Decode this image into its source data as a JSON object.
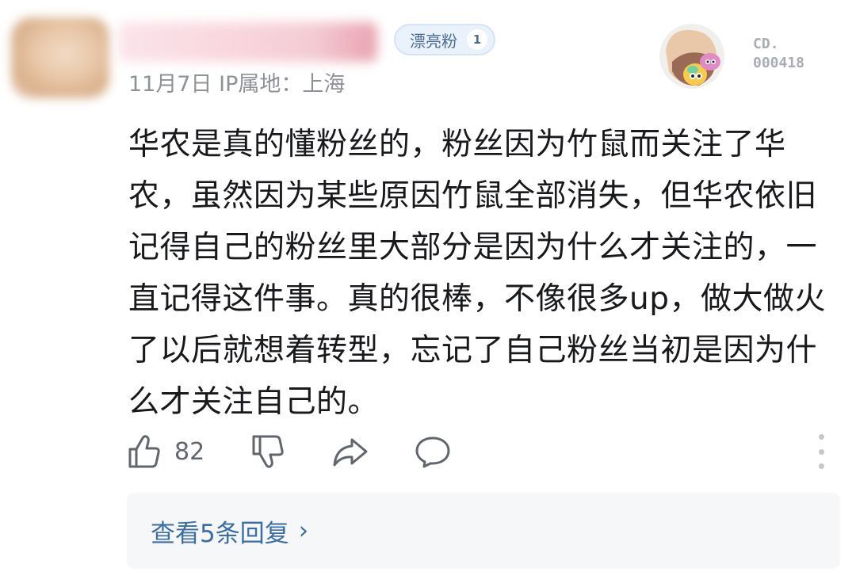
{
  "comment": {
    "fan_badge": {
      "label": "漂亮粉",
      "level": "1"
    },
    "meta": {
      "date": "11月7日",
      "ip_location": "IP属地：上海"
    },
    "decoration": {
      "icon": "cartoon-decoration-icon",
      "number_top": "CD.",
      "number_bottom": "000418"
    },
    "text": "华农是真的懂粉丝的，粉丝因为竹鼠而关注了华农，虽然因为某些原因竹鼠全部消失，但华农依旧记得自己的粉丝里大部分是因为什么才关注的，一直记得这件事。真的很棒，不像很多up，做大做火了以后就想着转型，忘记了自己粉丝当初是因为什么才关注自己的。",
    "actions": {
      "like_count": "82",
      "icons": [
        "thumbs-up-icon",
        "thumbs-down-icon",
        "share-icon",
        "reply-icon",
        "more-icon"
      ]
    },
    "replies": {
      "label": "查看5条回复",
      "chevron": "›"
    }
  },
  "colors": {
    "text": "#18191c",
    "meta": "#8e9297",
    "link": "#3b6ea5",
    "icon": "#61666d",
    "badge_bg": "#e9f1fb",
    "reply_bg": "#f6f7f8"
  }
}
